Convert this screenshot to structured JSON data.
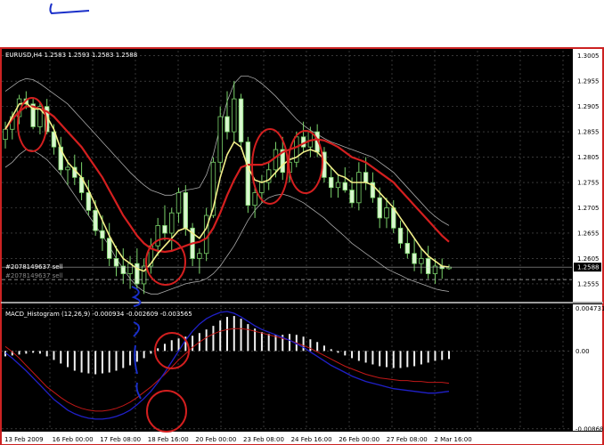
{
  "chart_data": [
    {
      "type": "candlestick",
      "title": "EURUSD,H4 1.2583 1.2593 1.2583 1.2588",
      "y_ticks": [
        "1.3005",
        "1.2955",
        "1.2905",
        "1.2855",
        "1.2805",
        "1.2755",
        "1.2705",
        "1.2655",
        "1.2605",
        "1.2555"
      ],
      "ylim": [
        1.2525,
        1.3015
      ],
      "current_price": "1.2588",
      "order_label": "#2078149637 sell",
      "order_label_2": "#2078149637 sell",
      "candles": [
        [
          1.284,
          1.2875,
          1.2822,
          1.286
        ],
        [
          1.286,
          1.2895,
          1.284,
          1.2885
        ],
        [
          1.2885,
          1.2928,
          1.287,
          1.292
        ],
        [
          1.292,
          1.2935,
          1.29,
          1.291
        ],
        [
          1.291,
          1.292,
          1.286,
          1.2865
        ],
        [
          1.2865,
          1.2915,
          1.285,
          1.2905
        ],
        [
          1.2905,
          1.292,
          1.285,
          1.2855
        ],
        [
          1.2855,
          1.287,
          1.281,
          1.2825
        ],
        [
          1.2825,
          1.2845,
          1.277,
          1.278
        ],
        [
          1.278,
          1.28,
          1.275,
          1.2785
        ],
        [
          1.2785,
          1.281,
          1.275,
          1.2765
        ],
        [
          1.2765,
          1.2795,
          1.272,
          1.2735
        ],
        [
          1.2735,
          1.276,
          1.269,
          1.27
        ],
        [
          1.27,
          1.272,
          1.265,
          1.266
        ],
        [
          1.266,
          1.269,
          1.262,
          1.2645
        ],
        [
          1.2645,
          1.2675,
          1.259,
          1.2605
        ],
        [
          1.2605,
          1.263,
          1.257,
          1.259
        ],
        [
          1.259,
          1.2625,
          1.2555,
          1.2575
        ],
        [
          1.2575,
          1.261,
          1.2545,
          1.2595
        ],
        [
          1.2595,
          1.2625,
          1.2545,
          1.2555
        ],
        [
          1.2555,
          1.2605,
          1.2535,
          1.259
        ],
        [
          1.259,
          1.2645,
          1.2575,
          1.263
        ],
        [
          1.263,
          1.2685,
          1.261,
          1.267
        ],
        [
          1.267,
          1.271,
          1.264,
          1.2655
        ],
        [
          1.2655,
          1.2705,
          1.262,
          1.2695
        ],
        [
          1.2695,
          1.2745,
          1.2675,
          1.2735
        ],
        [
          1.2735,
          1.275,
          1.265,
          1.2665
        ],
        [
          1.2665,
          1.2675,
          1.259,
          1.2605
        ],
        [
          1.2605,
          1.2625,
          1.2575,
          1.2615
        ],
        [
          1.2615,
          1.2705,
          1.26,
          1.269
        ],
        [
          1.269,
          1.2805,
          1.2685,
          1.2795
        ],
        [
          1.2795,
          1.2905,
          1.2775,
          1.2885
        ],
        [
          1.2885,
          1.2935,
          1.284,
          1.2855
        ],
        [
          1.2855,
          1.2955,
          1.2835,
          1.292
        ],
        [
          1.292,
          1.293,
          1.282,
          1.2835
        ],
        [
          1.2835,
          1.2845,
          1.2695,
          1.271
        ],
        [
          1.271,
          1.2745,
          1.2685,
          1.2735
        ],
        [
          1.2735,
          1.277,
          1.2715,
          1.2755
        ],
        [
          1.2755,
          1.2795,
          1.274,
          1.278
        ],
        [
          1.278,
          1.2835,
          1.2765,
          1.282
        ],
        [
          1.282,
          1.2845,
          1.276,
          1.2775
        ],
        [
          1.2775,
          1.2815,
          1.2755,
          1.2795
        ],
        [
          1.2795,
          1.2855,
          1.2785,
          1.2845
        ],
        [
          1.2845,
          1.2875,
          1.2815,
          1.2825
        ],
        [
          1.2825,
          1.2865,
          1.2805,
          1.2855
        ],
        [
          1.2855,
          1.287,
          1.2805,
          1.2815
        ],
        [
          1.2815,
          1.2825,
          1.2755,
          1.2765
        ],
        [
          1.2765,
          1.2785,
          1.2725,
          1.2745
        ],
        [
          1.2745,
          1.277,
          1.2725,
          1.2755
        ],
        [
          1.2755,
          1.2785,
          1.2735,
          1.274
        ],
        [
          1.274,
          1.2765,
          1.2705,
          1.2715
        ],
        [
          1.2715,
          1.2795,
          1.27,
          1.2775
        ],
        [
          1.2775,
          1.2805,
          1.274,
          1.2755
        ],
        [
          1.2755,
          1.2775,
          1.2715,
          1.2725
        ],
        [
          1.2725,
          1.2745,
          1.2665,
          1.2685
        ],
        [
          1.2685,
          1.2725,
          1.2665,
          1.2705
        ],
        [
          1.2705,
          1.272,
          1.2655,
          1.2665
        ],
        [
          1.2665,
          1.268,
          1.2625,
          1.2635
        ],
        [
          1.2635,
          1.2665,
          1.2605,
          1.2615
        ],
        [
          1.2615,
          1.2645,
          1.258,
          1.2595
        ],
        [
          1.2595,
          1.2625,
          1.2575,
          1.2605
        ],
        [
          1.2605,
          1.263,
          1.2565,
          1.2575
        ],
        [
          1.2575,
          1.2605,
          1.2555,
          1.259
        ],
        [
          1.259,
          1.2605,
          1.2565,
          1.2585
        ],
        [
          1.2585,
          1.2593,
          1.2583,
          1.2588
        ]
      ],
      "sma_yellow": [
        1.286,
        1.2885,
        1.291,
        1.2912,
        1.29,
        1.29,
        1.2885,
        1.286,
        1.282,
        1.2795,
        1.278,
        1.2765,
        1.274,
        1.271,
        1.268,
        1.265,
        1.2625,
        1.2605,
        1.2595,
        1.2585,
        1.258,
        1.2595,
        1.2615,
        1.263,
        1.2645,
        1.266,
        1.2665,
        1.2655,
        1.2645,
        1.2665,
        1.2705,
        1.2765,
        1.281,
        1.2835,
        1.2825,
        1.2785,
        1.276,
        1.2755,
        1.276,
        1.2775,
        1.279,
        1.28,
        1.2805,
        1.2815,
        1.282,
        1.2815,
        1.28,
        1.2785,
        1.277,
        1.2765,
        1.2755,
        1.2755,
        1.2755,
        1.275,
        1.2735,
        1.272,
        1.2705,
        1.2685,
        1.2665,
        1.2645,
        1.2625,
        1.261,
        1.26,
        1.259,
        1.2588
      ],
      "ema_red": [
        1.286,
        1.288,
        1.2895,
        1.2905,
        1.2905,
        1.29,
        1.2895,
        1.2885,
        1.287,
        1.2855,
        1.284,
        1.2825,
        1.2805,
        1.2785,
        1.2765,
        1.274,
        1.2715,
        1.269,
        1.267,
        1.265,
        1.2635,
        1.2625,
        1.262,
        1.2618,
        1.262,
        1.2625,
        1.263,
        1.2635,
        1.2638,
        1.2645,
        1.2665,
        1.2695,
        1.273,
        1.276,
        1.2785,
        1.279,
        1.279,
        1.279,
        1.2795,
        1.2805,
        1.2815,
        1.282,
        1.2825,
        1.2832,
        1.2838,
        1.284,
        1.2838,
        1.2832,
        1.2825,
        1.2815,
        1.2805,
        1.28,
        1.2795,
        1.2785,
        1.2775,
        1.2765,
        1.2755,
        1.274,
        1.2725,
        1.271,
        1.2695,
        1.268,
        1.2665,
        1.265,
        1.2638
      ],
      "bb_upper": [
        1.2935,
        1.2945,
        1.2955,
        1.296,
        1.2958,
        1.295,
        1.294,
        1.293,
        1.292,
        1.291,
        1.2895,
        1.288,
        1.2865,
        1.285,
        1.2835,
        1.282,
        1.2805,
        1.279,
        1.2775,
        1.2762,
        1.275,
        1.274,
        1.2735,
        1.273,
        1.273,
        1.2735,
        1.274,
        1.2742,
        1.2745,
        1.277,
        1.281,
        1.2865,
        1.2915,
        1.295,
        1.2965,
        1.2965,
        1.296,
        1.295,
        1.2938,
        1.2925,
        1.291,
        1.2895,
        1.288,
        1.2868,
        1.2858,
        1.285,
        1.2842,
        1.2835,
        1.283,
        1.2825,
        1.282,
        1.2815,
        1.281,
        1.2805,
        1.2795,
        1.2785,
        1.2775,
        1.276,
        1.2745,
        1.273,
        1.2715,
        1.27,
        1.2688,
        1.2678,
        1.267
      ],
      "bb_lower": [
        1.2785,
        1.2795,
        1.281,
        1.282,
        1.2818,
        1.281,
        1.28,
        1.2785,
        1.277,
        1.275,
        1.273,
        1.271,
        1.269,
        1.267,
        1.265,
        1.263,
        1.2605,
        1.2585,
        1.2565,
        1.255,
        1.254,
        1.2535,
        1.2535,
        1.254,
        1.2545,
        1.255,
        1.2555,
        1.2558,
        1.256,
        1.2565,
        1.2575,
        1.259,
        1.261,
        1.263,
        1.2655,
        1.268,
        1.27,
        1.2715,
        1.2725,
        1.273,
        1.2732,
        1.2728,
        1.2722,
        1.2715,
        1.2705,
        1.2695,
        1.2685,
        1.2672,
        1.266,
        1.2648,
        1.2635,
        1.2625,
        1.2615,
        1.2605,
        1.2595,
        1.2585,
        1.2578,
        1.2572,
        1.2565,
        1.256,
        1.2555,
        1.255,
        1.2545,
        1.2542,
        1.254
      ]
    },
    {
      "type": "bar",
      "title": "MACD_Histogram (12,26,9) -0.000934 -0.002609 -0.003565",
      "y_ticks": [
        "0.004731",
        "0.00",
        "-0.008682"
      ],
      "ylim": [
        -0.0087,
        0.0048
      ],
      "x_ticks": [
        "13 Feb 2009",
        "16 Feb 00:00",
        "17 Feb 08:00",
        "18 Feb 16:00",
        "20 Feb 00:00",
        "23 Feb 08:00",
        "24 Feb 16:00",
        "26 Feb 00:00",
        "27 Feb 08:00",
        "2 Mar 16:00"
      ],
      "histogram": [
        -0.0006,
        -0.0005,
        -0.0004,
        -0.0003,
        -0.0002,
        -0.0003,
        -0.0006,
        -0.001,
        -0.0014,
        -0.0018,
        -0.0022,
        -0.0024,
        -0.0025,
        -0.0026,
        -0.0025,
        -0.0024,
        -0.0022,
        -0.0019,
        -0.0016,
        -0.0012,
        -0.0008,
        -0.0003,
        0.0003,
        0.0008,
        0.0012,
        0.0014,
        0.0016,
        0.0017,
        0.002,
        0.0024,
        0.0028,
        0.0034,
        0.0038,
        0.0039,
        0.0036,
        0.003,
        0.0025,
        0.0021,
        0.0019,
        0.0018,
        0.0018,
        0.0019,
        0.0018,
        0.0016,
        0.0013,
        0.001,
        0.0006,
        0.0002,
        -0.0002,
        -0.0005,
        -0.0008,
        -0.0011,
        -0.0013,
        -0.0015,
        -0.0017,
        -0.0018,
        -0.0019,
        -0.0019,
        -0.0018,
        -0.0017,
        -0.0015,
        -0.0013,
        -0.0011,
        -0.001,
        -0.0009
      ],
      "red_line": [
        0.0005,
        -0.0001,
        -0.0008,
        -0.0016,
        -0.0024,
        -0.0032,
        -0.004,
        -0.0046,
        -0.0052,
        -0.0057,
        -0.0061,
        -0.0064,
        -0.0066,
        -0.0067,
        -0.0067,
        -0.0066,
        -0.0064,
        -0.0061,
        -0.0057,
        -0.0052,
        -0.0046,
        -0.004,
        -0.0033,
        -0.0026,
        -0.0018,
        -0.001,
        -0.0003,
        0.0004,
        0.001,
        0.0015,
        0.0019,
        0.0022,
        0.0024,
        0.0025,
        0.0025,
        0.0024,
        0.0022,
        0.002,
        0.0018,
        0.0016,
        0.0014,
        0.0012,
        0.0009,
        0.0006,
        0.0003,
        -0.0001,
        -0.0005,
        -0.0009,
        -0.0013,
        -0.0017,
        -0.002,
        -0.0023,
        -0.0026,
        -0.0028,
        -0.003,
        -0.0031,
        -0.0032,
        -0.0033,
        -0.0033,
        -0.0034,
        -0.0034,
        -0.0035,
        -0.0035,
        -0.0035,
        -0.0036
      ],
      "blue_line": [
        -0.0002,
        -0.0008,
        -0.0015,
        -0.0022,
        -0.003,
        -0.0038,
        -0.0046,
        -0.0054,
        -0.006,
        -0.0066,
        -0.007,
        -0.0073,
        -0.0075,
        -0.0076,
        -0.0076,
        -0.0075,
        -0.0073,
        -0.007,
        -0.0066,
        -0.006,
        -0.0053,
        -0.0045,
        -0.0035,
        -0.0024,
        -0.0012,
        0.0,
        0.0012,
        0.0022,
        0.003,
        0.0036,
        0.004,
        0.0043,
        0.0044,
        0.0042,
        0.0038,
        0.0033,
        0.0028,
        0.0024,
        0.0021,
        0.0018,
        0.0015,
        0.0012,
        0.0008,
        0.0004,
        -0.0001,
        -0.0006,
        -0.0011,
        -0.0016,
        -0.002,
        -0.0024,
        -0.0028,
        -0.0031,
        -0.0034,
        -0.0036,
        -0.0038,
        -0.004,
        -0.0042,
        -0.0043,
        -0.0044,
        -0.0045,
        -0.0046,
        -0.0047,
        -0.0047,
        -0.0046,
        -0.0045
      ]
    }
  ]
}
